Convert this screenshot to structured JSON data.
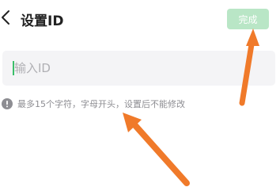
{
  "header": {
    "back_icon": "chevron-left-icon",
    "title": "设置ID",
    "done_label": "完成"
  },
  "input": {
    "placeholder": "输入ID",
    "value": ""
  },
  "hint": {
    "icon": "exclamation-circle-icon",
    "text": "最多15个字符，字母开头，设置后不能修改"
  },
  "colors": {
    "done_button_bg": "#b9e6c6",
    "caret": "#3bbf6a",
    "arrow": "#f07a2a",
    "input_bg": "#f4f4f6",
    "hint_text": "#8d8d92"
  }
}
